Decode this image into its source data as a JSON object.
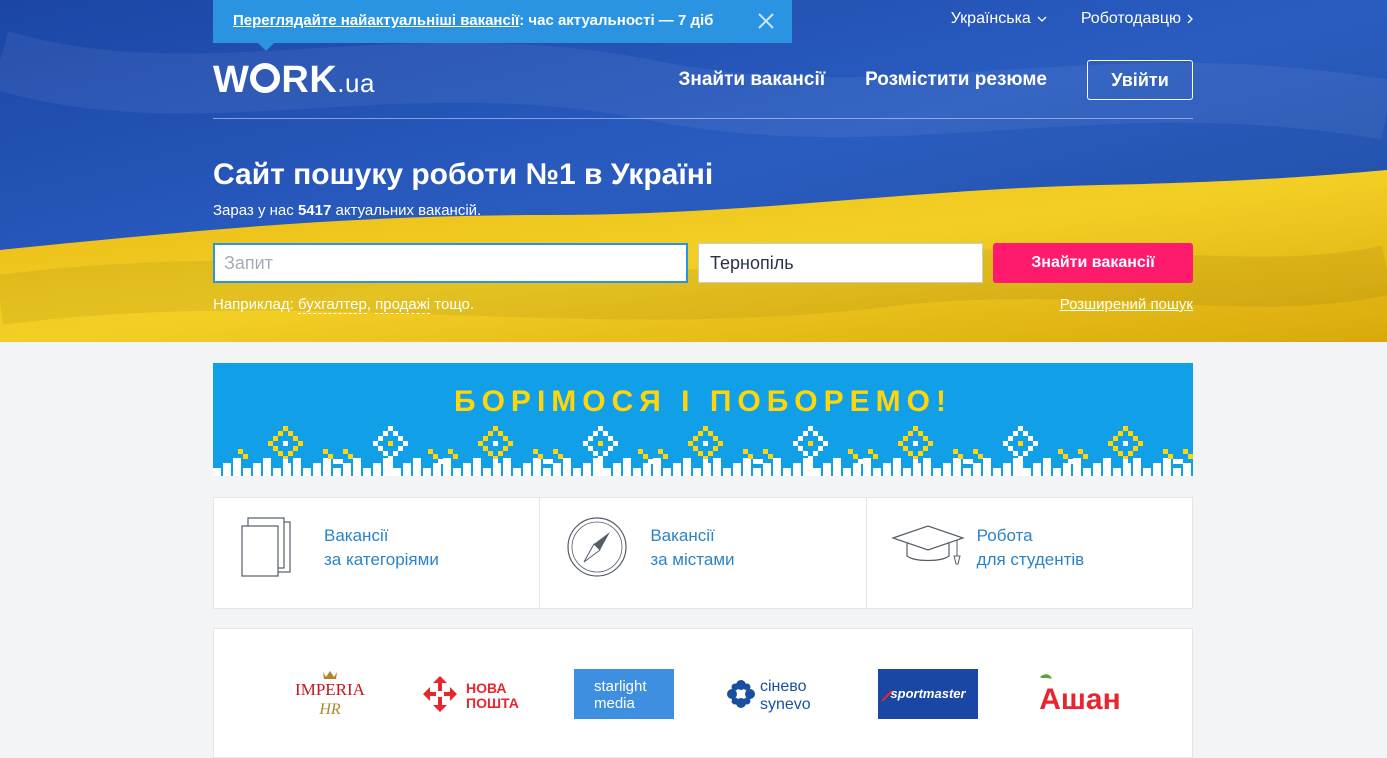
{
  "notice": {
    "link_text": "Переглядайте найактуальніші вакансії",
    "rest_text": ": час актуальності — 7 діб"
  },
  "topnav": {
    "language": "Українська",
    "employer": "Роботодавцю"
  },
  "logo": {
    "main": "WORK",
    "suffix": ".ua"
  },
  "mainnav": {
    "find_jobs": "Знайти вакансії",
    "post_resume": "Розмістити резюме",
    "login": "Увійти"
  },
  "hero": {
    "title": "Сайт пошуку роботи №1 в Україні",
    "sub_prefix": "Зараз у нас ",
    "vacancy_count": "5417",
    "sub_suffix": " актуальних вакансій."
  },
  "search": {
    "query_placeholder": "Запит",
    "city_value": "Тернопіль",
    "submit_label": "Знайти вакансії",
    "example_prefix": "Наприклад: ",
    "example_1": "бухгалтер",
    "example_sep": ", ",
    "example_2": "продажі",
    "example_suffix": " тощо.",
    "advanced": "Розширений пошук"
  },
  "banner": {
    "title": "БОРІМОСЯ І ПОБОРЕМО!"
  },
  "categories": [
    {
      "line1": "Вакансії",
      "line2": "за категоріями",
      "icon": "documents-icon"
    },
    {
      "line1": "Вакансії",
      "line2": "за містами",
      "icon": "compass-icon"
    },
    {
      "line1": "Робота",
      "line2": "для студентів",
      "icon": "graduation-cap-icon"
    }
  ],
  "employers": {
    "imperia_1": "IMPERIA",
    "imperia_2": "HR",
    "nova_1": "НОВА",
    "nova_2": "ПОШТА",
    "starlight_1": "starlight",
    "starlight_2": "media",
    "synevo_1": "сінево",
    "synevo_2": "synevo",
    "sportmaster": "sportmaster",
    "auchan": "Ашан"
  },
  "colors": {
    "accent_blue": "#2a93e2",
    "cta_pink": "#ff1a6d",
    "link_blue": "#2a83c9",
    "banner_blue": "#119fe8",
    "banner_yellow": "#ffd60a"
  }
}
